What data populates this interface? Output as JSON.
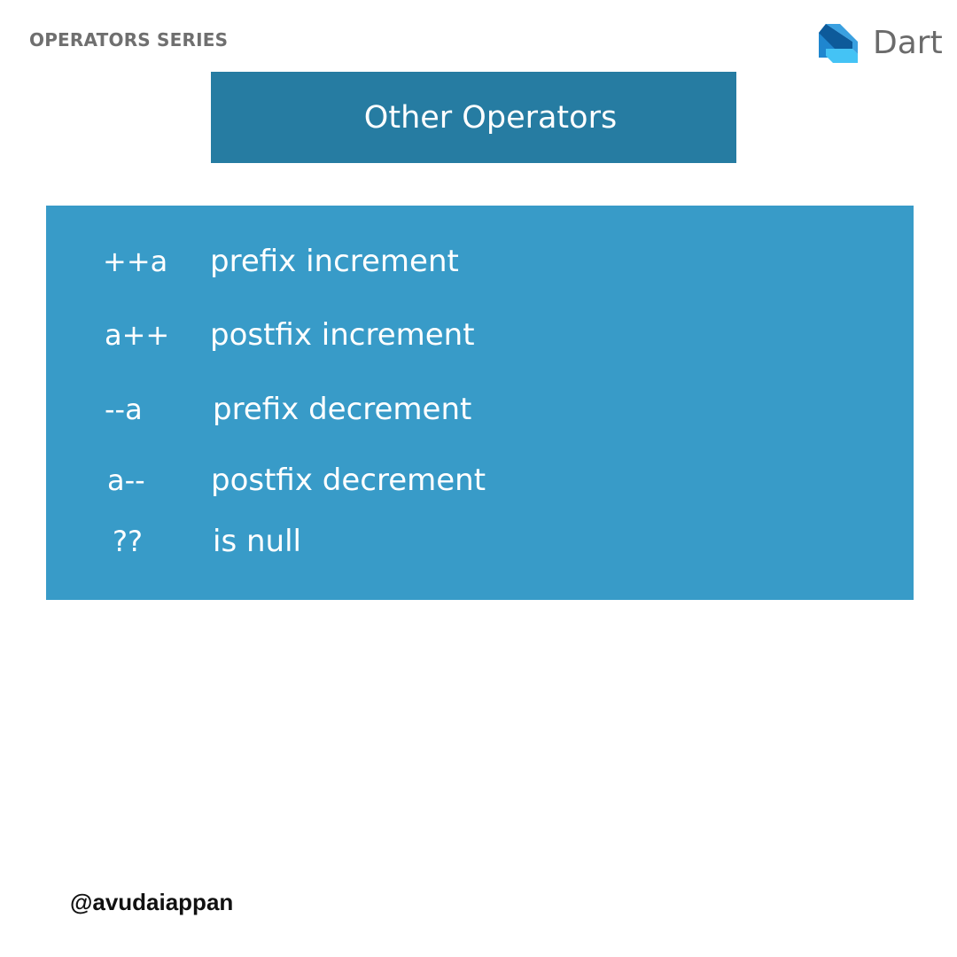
{
  "header": {
    "series_label": "OPERATORS SERIES"
  },
  "brand": {
    "name": "Dart",
    "logo_icon": "dart-logo-icon",
    "logo_colors": {
      "dark": "#0d5a9a",
      "mid": "#1f86cf",
      "light": "#44c3f5"
    }
  },
  "title": {
    "text": "Other Operators",
    "background": "#267ca2"
  },
  "panel": {
    "background": "#389bc8",
    "operators": [
      {
        "symbol": "++a",
        "description": "prefix increment"
      },
      {
        "symbol": "a++",
        "description": "postfix increment"
      },
      {
        "symbol": "--a",
        "description": "prefix decrement"
      },
      {
        "symbol": "a--",
        "description": "postfix decrement"
      },
      {
        "symbol": "??",
        "description": "is null"
      }
    ]
  },
  "footer": {
    "handle": "@avudaiappan"
  }
}
